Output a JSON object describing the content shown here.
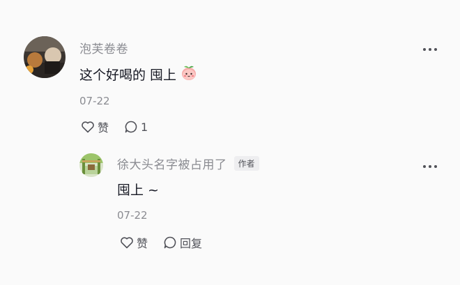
{
  "comment": {
    "author": "泡芙卷卷",
    "avatar_icon": "user-photo-avatar",
    "text": "这个好喝的 囤上",
    "emoji_icon": "peach-face-emoji",
    "date": "07-22",
    "like_label": "赞",
    "reply_count": "1",
    "more_icon": "more-dots-icon"
  },
  "reply": {
    "author": "徐大头名字被占用了",
    "badge": "作者",
    "avatar_icon": "user-photo-avatar",
    "text": "囤上 ~",
    "date": "07-22",
    "like_label": "赞",
    "reply_label": "回复",
    "more_icon": "more-dots-icon"
  },
  "colors": {
    "background": "#fafafa",
    "primary_text": "#161823",
    "secondary_text": "#8a8b91",
    "action_text": "#505158"
  }
}
